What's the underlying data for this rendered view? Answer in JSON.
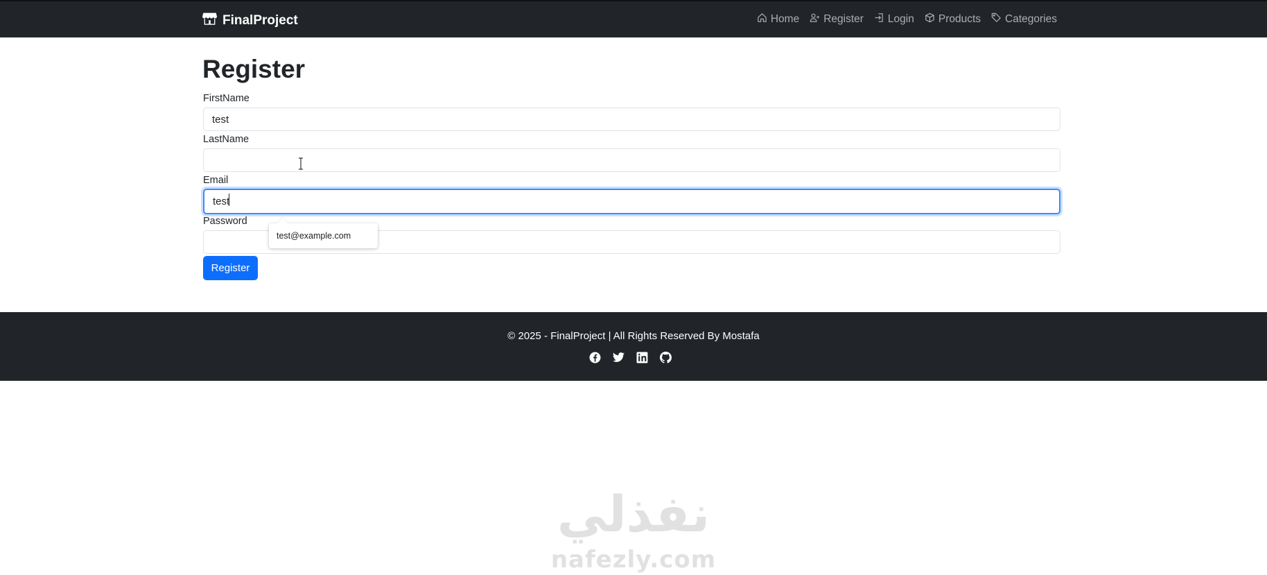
{
  "navbar": {
    "brand": "FinalProject",
    "links": [
      {
        "label": "Home",
        "icon": "house-icon"
      },
      {
        "label": "Register",
        "icon": "person-plus-icon"
      },
      {
        "label": "Login",
        "icon": "box-arrow-in-icon"
      },
      {
        "label": "Products",
        "icon": "box-icon"
      },
      {
        "label": "Categories",
        "icon": "tags-icon"
      }
    ]
  },
  "form": {
    "title": "Register",
    "first_name_label": "FirstName",
    "first_name_value": "test",
    "last_name_label": "LastName",
    "last_name_value": "",
    "email_label": "Email",
    "email_value": "test",
    "password_label": "Password",
    "password_value": "",
    "autocomplete_suggestion": "test@example.com",
    "submit_label": "Register"
  },
  "footer": {
    "text": "© 2025 - FinalProject | All Rights Reserved By Mostafa",
    "social": [
      "facebook-icon",
      "twitter-icon",
      "linkedin-icon",
      "github-icon"
    ]
  },
  "watermark": {
    "arabic": "نفذلي",
    "latin": "nafezly.com"
  },
  "colors": {
    "navbar_bg": "#212529",
    "primary": "#0d6efd",
    "focus_border": "#3d8bfd"
  }
}
